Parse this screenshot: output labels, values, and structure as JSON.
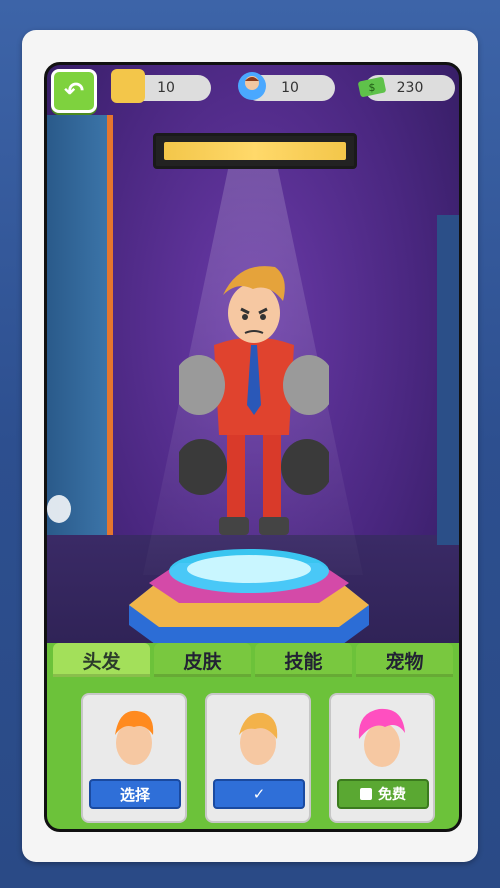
{
  "hud": {
    "puzzle_count": "10",
    "gem_count": "10",
    "cash_count": "230"
  },
  "tabs": [
    {
      "label": "头发",
      "active": true
    },
    {
      "label": "皮肤",
      "active": false
    },
    {
      "label": "技能",
      "active": false
    },
    {
      "label": "宠物",
      "active": false
    }
  ],
  "items": [
    {
      "hair_color": "#ff8a1f",
      "button_label": "选择",
      "button_style": "blue"
    },
    {
      "hair_color": "#f3b24a",
      "button_label": "✓",
      "button_style": "blue"
    },
    {
      "hair_color": "#ff4fc0",
      "button_label": "免费",
      "button_style": "green"
    }
  ],
  "colors": {
    "accent_green": "#6cc23a",
    "select_blue": "#2f6fd8",
    "scene_purple": "#4a2780"
  }
}
